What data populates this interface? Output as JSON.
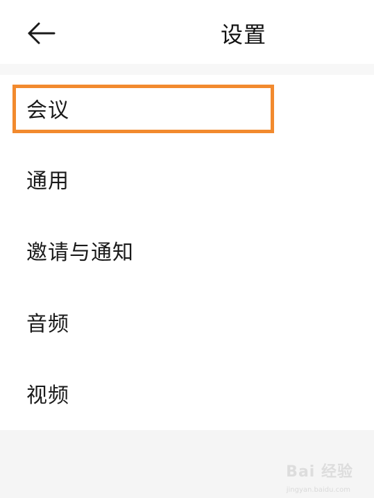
{
  "header": {
    "title": "设置",
    "back_icon": "arrow-left-icon"
  },
  "menu": {
    "items": [
      {
        "label": "会议",
        "highlighted": true
      },
      {
        "label": "通用"
      },
      {
        "label": "邀请与通知"
      },
      {
        "label": "音频"
      },
      {
        "label": "视频"
      }
    ]
  },
  "colors": {
    "highlight": "#f28a2e",
    "background": "#ffffff",
    "separator": "#f7f7f7"
  },
  "watermark": {
    "text": "Bai 经验",
    "sub": "jingyan.baidu.com"
  }
}
